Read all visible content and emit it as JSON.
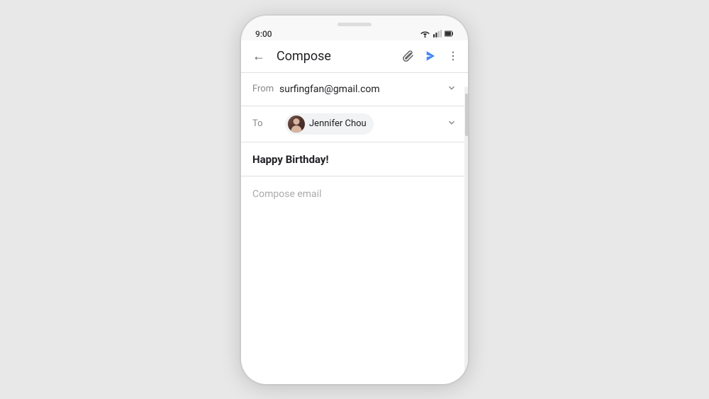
{
  "status_bar": {
    "time": "9:00",
    "wifi_icon": "wifi",
    "signal_icon": "signal",
    "battery_icon": "battery"
  },
  "app_bar": {
    "back_icon": "←",
    "title": "Compose",
    "attach_icon": "attach",
    "send_icon": "send",
    "more_icon": "more"
  },
  "from_row": {
    "label": "From",
    "value": "surfingfan@gmail.com",
    "expand": "▾"
  },
  "to_row": {
    "label": "To",
    "recipient_name": "Jennifer Chou",
    "expand": "▾"
  },
  "subject_row": {
    "value": "Happy Birthday!"
  },
  "body_row": {
    "placeholder": "Compose email"
  },
  "colors": {
    "send_blue": "#4285f4",
    "text_dark": "#202124",
    "text_muted": "#888888",
    "border": "#e0e0e0",
    "chip_bg": "#f1f3f4"
  }
}
